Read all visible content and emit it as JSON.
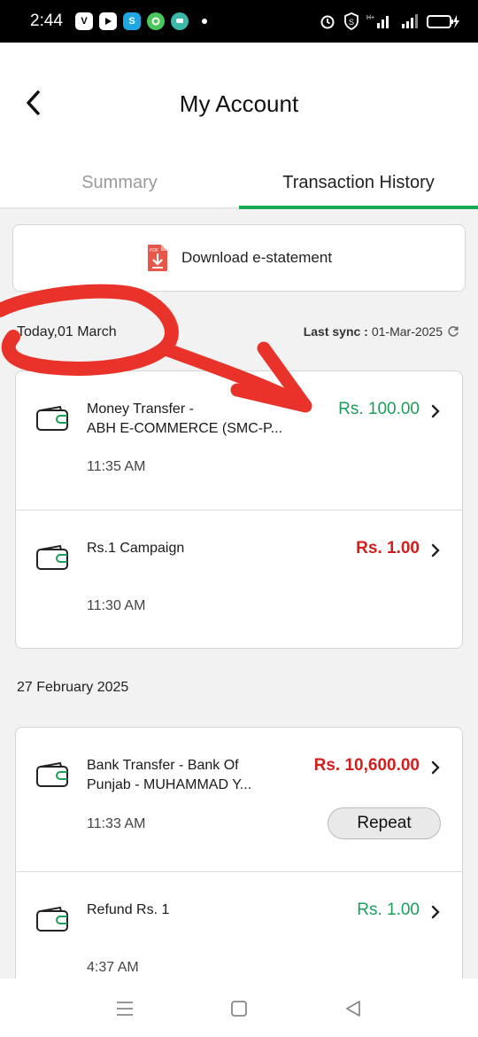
{
  "status_bar": {
    "time": "2:44",
    "notification_icons": [
      "v-icon",
      "youtube-icon",
      "skype-icon",
      "green-app-icon",
      "messages-icon"
    ],
    "system_icons": [
      "alarm-icon",
      "s-icon",
      "signal-icon",
      "signal-icon",
      "battery-icon"
    ]
  },
  "header": {
    "title": "My Account",
    "back_icon": "chevron-left-icon"
  },
  "tabs": [
    {
      "label": "Summary",
      "active": false
    },
    {
      "label": "Transaction History",
      "active": true
    }
  ],
  "colors": {
    "accent_green": "#18a957",
    "amount_green": "#1b9e5a",
    "amount_red": "#d41e1e",
    "annotation_red": "#e8322a"
  },
  "download": {
    "label": "Download e-statement",
    "icon": "pdf-icon"
  },
  "sync": {
    "label": "Last sync :",
    "date": "01-Mar-2025",
    "icon": "refresh-icon"
  },
  "groups": [
    {
      "date": "Today,01 March",
      "transactions": [
        {
          "title_line1": "Money Transfer -",
          "title_line2": "ABH E-COMMERCE (SMC-P...",
          "amount": "Rs. 100.00",
          "color": "green",
          "time": "11:35 AM"
        },
        {
          "title_line1": "Rs.1 Campaign",
          "title_line2": "",
          "amount": "Rs. 1.00",
          "color": "red",
          "time": "11:30 AM"
        }
      ]
    },
    {
      "date": "27 February 2025",
      "transactions": [
        {
          "title_line1": "Bank Transfer - Bank Of",
          "title_line2": "Punjab - MUHAMMAD Y...",
          "amount": "Rs. 10,600.00",
          "color": "red",
          "time": "11:33 AM",
          "action": "Repeat"
        },
        {
          "title_line1": "Refund Rs. 1",
          "title_line2": "",
          "amount": "Rs. 1.00",
          "color": "green",
          "time": "4:37 AM"
        }
      ]
    }
  ],
  "nav_bar": {
    "icons": [
      "menu-icon",
      "home-square-icon",
      "back-triangle-icon"
    ]
  }
}
